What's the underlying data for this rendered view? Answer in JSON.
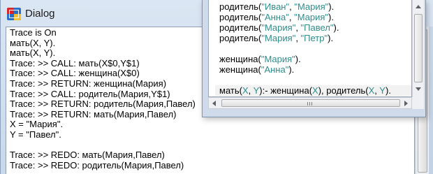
{
  "dialog": {
    "title": "Dialog",
    "lines": [
      "Trace is On",
      "мать(X, Y).",
      "мать(X, Y).",
      "Trace: >> CALL: мать(X$0,Y$1)",
      "Trace: >> CALL: женщина(X$0)",
      "Trace: >> RETURN: женщина(Мария)",
      "Trace: >> CALL: родитель(Мария,Y$1)",
      "Trace: >> RETURN: родитель(Мария,Павел)",
      "Trace: >> RETURN: мать(Мария,Павел)",
      "X = \"Мария\".",
      "Y = \"Павел\".",
      "",
      "Trace: >> REDO: мать(Мария,Павел)",
      "Trace: >> REDO: родитель(Мария,Павел)"
    ]
  },
  "editor": {
    "code": [
      {
        "pred": "родитель",
        "args": [
          "\"Иван\"",
          "\"Мария\""
        ]
      },
      {
        "pred": "родитель",
        "args": [
          "\"Анна\"",
          "\"Мария\""
        ]
      },
      {
        "pred": "родитель",
        "args": [
          "\"Мария\"",
          "\"Павел\""
        ]
      },
      {
        "pred": "родитель",
        "args": [
          "\"Мария\"",
          "\"Петр\""
        ]
      },
      {
        "pred": "",
        "args": []
      },
      {
        "pred": "женщина",
        "args": [
          "\"Мария\""
        ]
      },
      {
        "pred": "женщина",
        "args": [
          "\"Анна\""
        ]
      },
      {
        "pred": "",
        "args": []
      }
    ],
    "rule": {
      "head": "мать",
      "head_args": [
        "X",
        "Y"
      ],
      "neck": ":- ",
      "body1": "женщина",
      "body1_args": [
        "X"
      ],
      "body2": "родитель",
      "body2_args": [
        "X",
        "Y"
      ]
    }
  },
  "colors": {
    "string_literal": "#2f8c8c",
    "variable": "#2f8c8c",
    "window_frame": "#cfdbea"
  },
  "icons": {
    "dialog_icon": "visual-prolog-app-icon"
  }
}
